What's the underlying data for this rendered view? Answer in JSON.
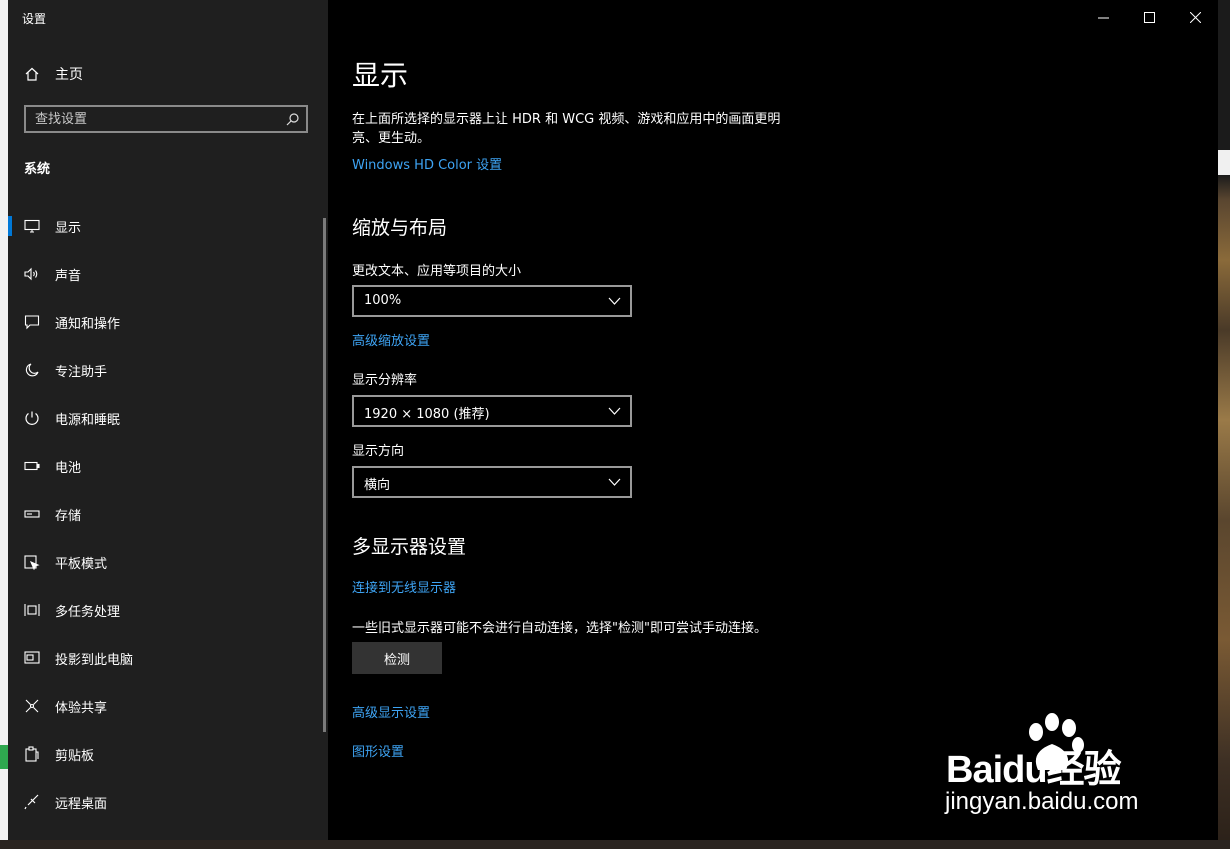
{
  "window": {
    "title": "设置"
  },
  "sidebar": {
    "home_label": "主页",
    "search_placeholder": "查找设置",
    "section": "系统",
    "items": [
      {
        "label": "显示",
        "icon": "monitor-icon",
        "active": true
      },
      {
        "label": "声音",
        "icon": "speaker-icon"
      },
      {
        "label": "通知和操作",
        "icon": "notification-icon"
      },
      {
        "label": "专注助手",
        "icon": "moon-icon"
      },
      {
        "label": "电源和睡眠",
        "icon": "power-icon"
      },
      {
        "label": "电池",
        "icon": "battery-icon"
      },
      {
        "label": "存储",
        "icon": "storage-icon"
      },
      {
        "label": "平板模式",
        "icon": "tablet-mode-icon"
      },
      {
        "label": "多任务处理",
        "icon": "multitask-icon"
      },
      {
        "label": "投影到此电脑",
        "icon": "project-icon"
      },
      {
        "label": "体验共享",
        "icon": "share-icon"
      },
      {
        "label": "剪贴板",
        "icon": "clipboard-icon"
      },
      {
        "label": "远程桌面",
        "icon": "remote-desktop-icon"
      }
    ]
  },
  "main": {
    "title": "显示",
    "hdr_description": "在上面所选择的显示器上让 HDR 和 WCG 视频、游戏和应用中的画面更明亮、更生动。",
    "hdr_link": "Windows HD Color 设置",
    "scale_heading": "缩放与布局",
    "scale_label": "更改文本、应用等项目的大小",
    "scale_value": "100%",
    "advanced_scaling_link": "高级缩放设置",
    "resolution_label": "显示分辨率",
    "resolution_value": "1920 × 1080 (推荐)",
    "orientation_label": "显示方向",
    "orientation_value": "横向",
    "multi_heading": "多显示器设置",
    "wireless_link": "连接到无线显示器",
    "detect_text": "一些旧式显示器可能不会进行自动连接，选择\"检测\"即可尝试手动连接。",
    "detect_button": "检测",
    "advanced_display_link": "高级显示设置",
    "graphics_link": "图形设置"
  },
  "watermark": {
    "brand": "Baidu经验",
    "url": "jingyan.baidu.com"
  },
  "colors": {
    "accent": "#0078d7",
    "link": "#3ea4f4",
    "sidebar_bg": "#1f1f1f",
    "content_bg": "#000000"
  }
}
